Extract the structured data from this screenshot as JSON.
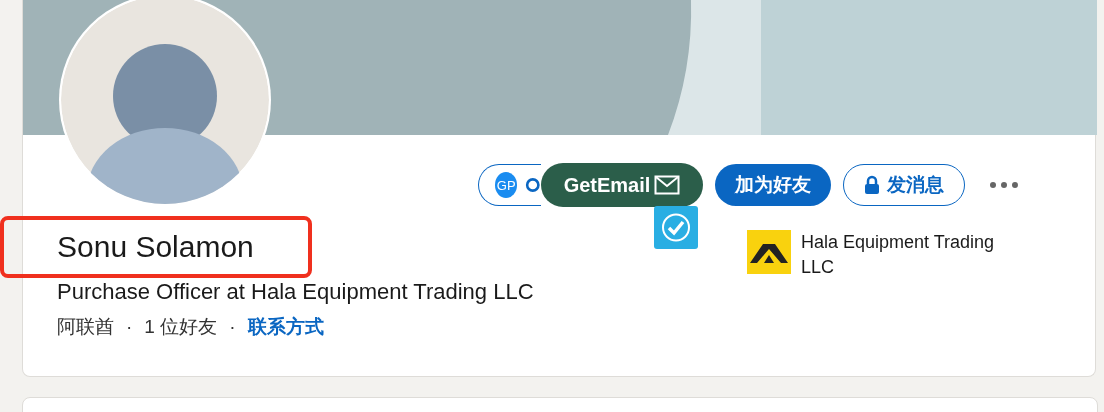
{
  "profile": {
    "name": "Sonu Solamon",
    "highlighted": true,
    "headline": "Purchase Officer at Hala Equipment Trading LLC",
    "meta": [
      {
        "kind": "text",
        "text": "阿联酋"
      },
      {
        "kind": "separator",
        "text": "·"
      },
      {
        "kind": "text",
        "text": "1 位好友"
      },
      {
        "kind": "separator",
        "text": "·"
      },
      {
        "kind": "link",
        "text": "联系方式"
      }
    ]
  },
  "actions": [
    {
      "kind": "extension",
      "text": "GP"
    },
    {
      "kind": "primary",
      "text": "加为好友"
    },
    {
      "kind": "secondary",
      "text": "发消息",
      "locked": true
    },
    {
      "kind": "more"
    }
  ],
  "overlay": {
    "text": "GetEmail"
  },
  "company": {
    "name": "Hala Equipment Trading LLC"
  }
}
